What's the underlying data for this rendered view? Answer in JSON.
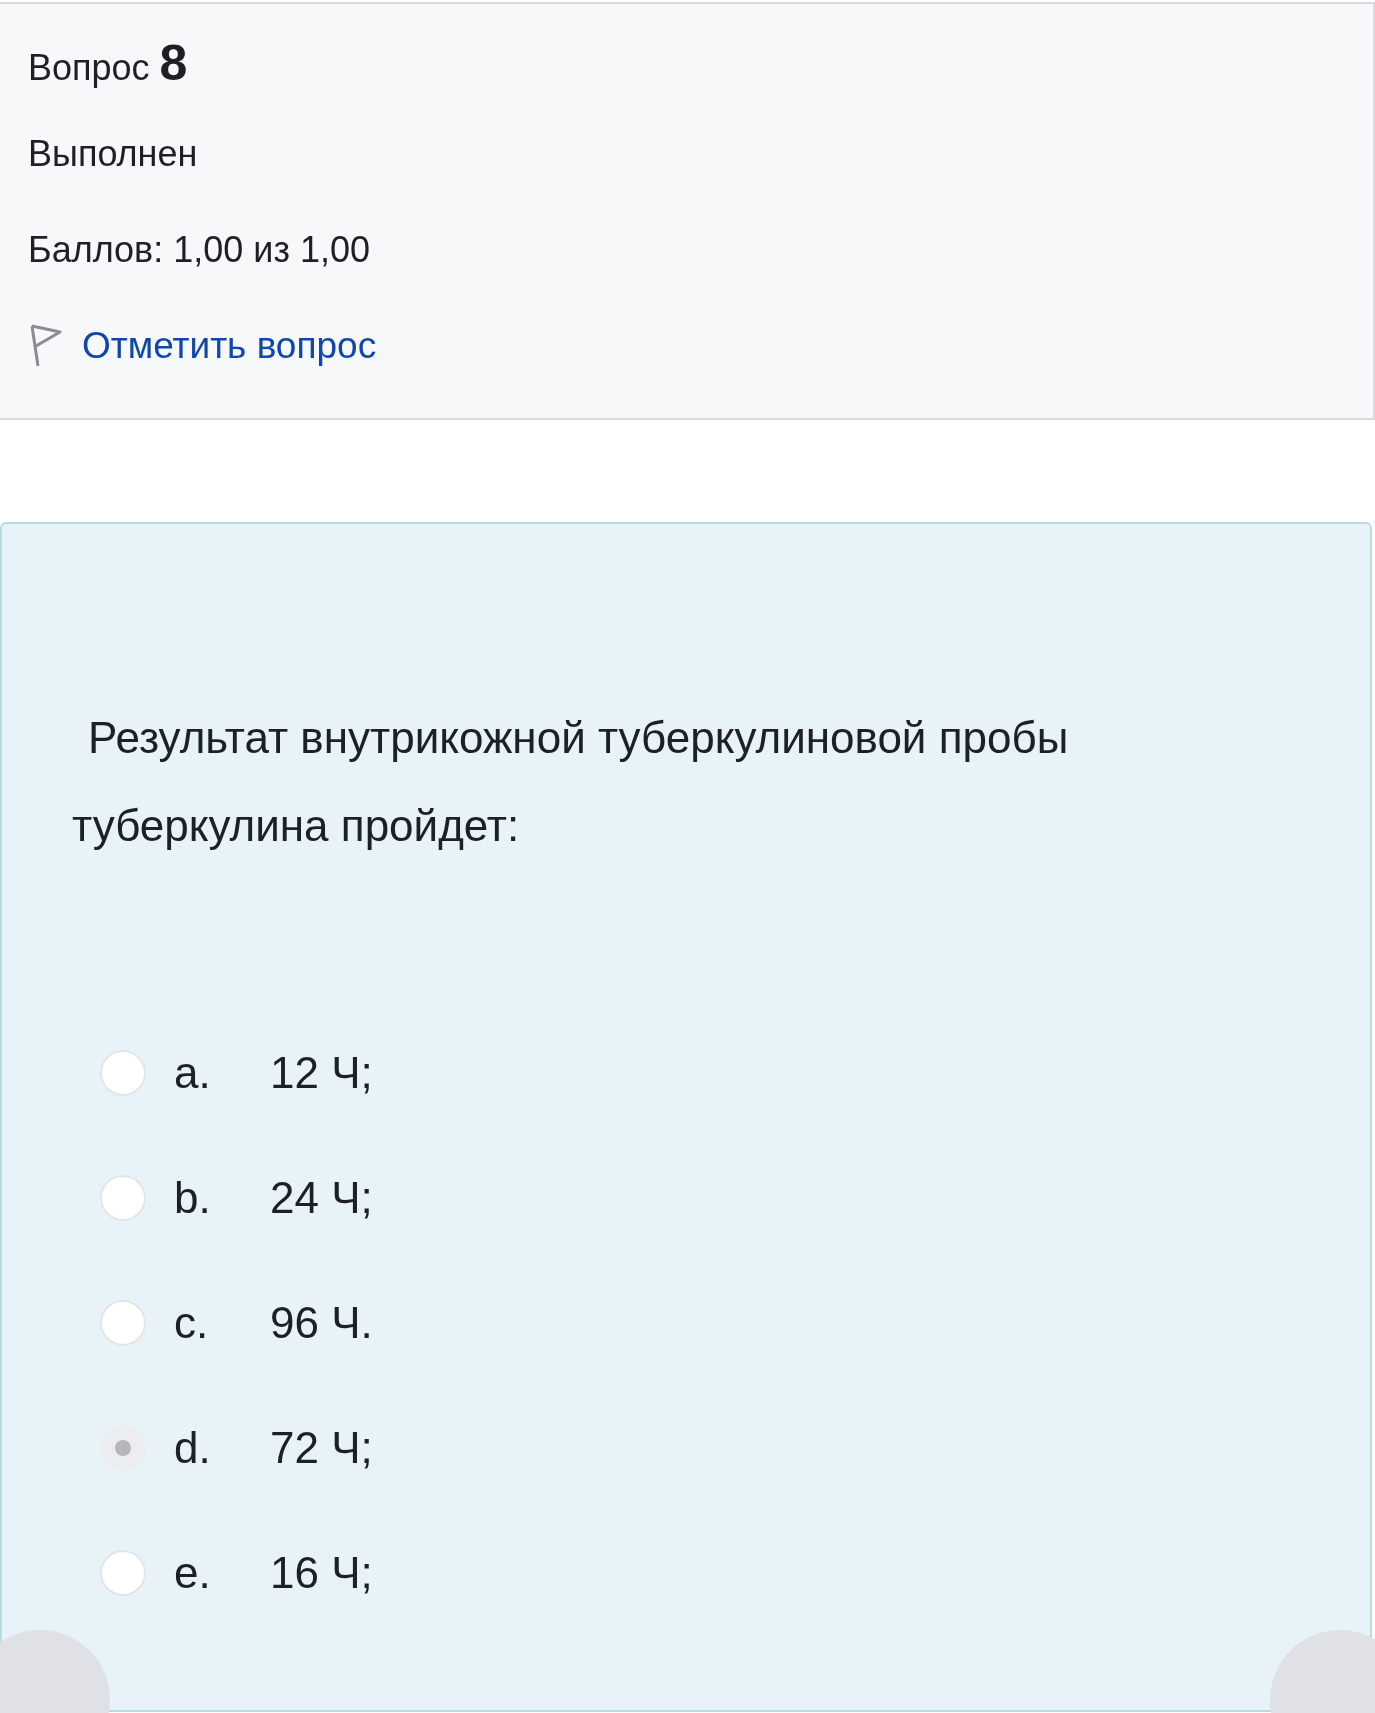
{
  "info": {
    "label": "Вопрос",
    "number": "8",
    "status": "Выполнен",
    "grade": "Баллов: 1,00 из 1,00",
    "flag_link": "Отметить вопрос"
  },
  "question": {
    "text_lines": [
      "Результат внутрикожной туберкулиновой пробы",
      "туберкулина пройдет:"
    ],
    "options": [
      {
        "letter": "a.",
        "text": "12 Ч;",
        "selected": false
      },
      {
        "letter": "b.",
        "text": "24 Ч;",
        "selected": false
      },
      {
        "letter": "c.",
        "text": "96 Ч.",
        "selected": false
      },
      {
        "letter": "d.",
        "text": "72 Ч;",
        "selected": true
      },
      {
        "letter": "e.",
        "text": "16 Ч;",
        "selected": false
      }
    ]
  }
}
